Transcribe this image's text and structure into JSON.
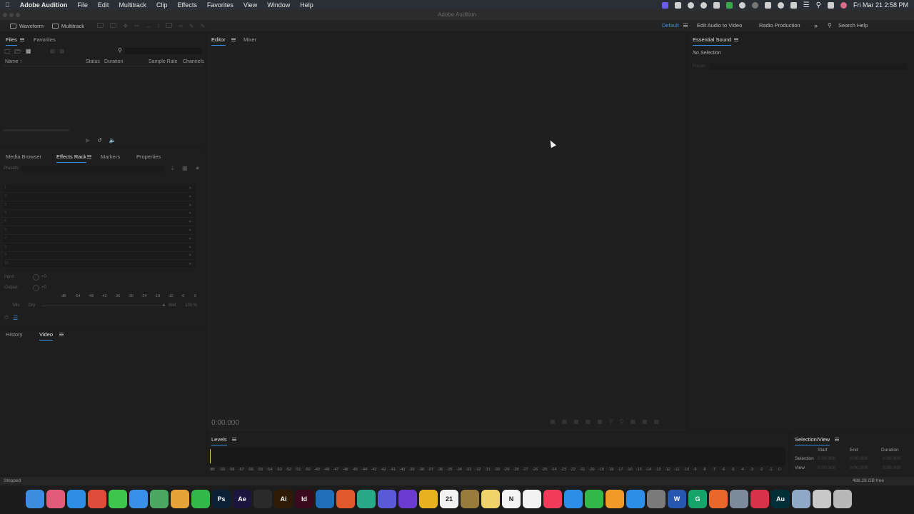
{
  "menubar": {
    "app_name": "Adobe Audition",
    "items": [
      "File",
      "Edit",
      "Multitrack",
      "Clip",
      "Effects",
      "Favorites",
      "View",
      "Window",
      "Help"
    ],
    "clock": "Fri Mar 21  2:58 PM"
  },
  "window": {
    "title": "Adobe Audition"
  },
  "toolbar": {
    "waveform_label": "Waveform",
    "multitrack_label": "Multitrack",
    "workspaces": [
      "Default",
      "Edit Audio to Video",
      "Radio Production"
    ],
    "search_placeholder": "Search Help",
    "accent": "#3b8fe8"
  },
  "files_panel": {
    "tabs": [
      "Files",
      "Favorites"
    ],
    "columns": [
      "Name ↑",
      "Status",
      "Duration",
      "Sample Rate",
      "Channels"
    ]
  },
  "effects_panel": {
    "tabs": [
      "Media Browser",
      "Effects Rack",
      "Markers",
      "Properties"
    ],
    "presets_label": "Presets:",
    "slots": [
      "1",
      "2",
      "3",
      "4",
      "5",
      "6",
      "7",
      "8",
      "9",
      "10"
    ],
    "input_label": "Input:",
    "input_value": "+0",
    "output_label": "Output:",
    "output_value": "+0",
    "meter_ticks": [
      "dB",
      "-54",
      "-48",
      "-42",
      "-36",
      "-30",
      "-24",
      "-18",
      "-12",
      "-6",
      "0"
    ],
    "mix_label": "Mix:",
    "dry_label": "Dry",
    "wet_label": "Wet",
    "wet_value": "100 %"
  },
  "history_panel": {
    "tabs": [
      "History",
      "Video"
    ]
  },
  "editor_panel": {
    "tabs": [
      "Editor",
      "Mixer"
    ],
    "time": "0:00.000"
  },
  "essential_sound": {
    "title": "Essential Sound",
    "no_selection": "No Selection",
    "preset_label": "Preset:"
  },
  "levels_panel": {
    "title": "Levels",
    "ruler": [
      "dB",
      "-59",
      "-58",
      "-57",
      "-56",
      "-55",
      "-54",
      "-53",
      "-52",
      "-51",
      "-50",
      "-49",
      "-48",
      "-47",
      "-46",
      "-45",
      "-44",
      "-43",
      "-42",
      "-41",
      "-40",
      "-39",
      "-38",
      "-37",
      "-36",
      "-35",
      "-34",
      "-33",
      "-32",
      "-31",
      "-30",
      "-29",
      "-28",
      "-27",
      "-26",
      "-25",
      "-24",
      "-23",
      "-22",
      "-21",
      "-20",
      "-19",
      "-18",
      "-17",
      "-16",
      "-15",
      "-14",
      "-13",
      "-12",
      "-11",
      "-10",
      "-9",
      "-8",
      "-7",
      "-6",
      "-5",
      "-4",
      "-3",
      "-2",
      "-1",
      "0"
    ]
  },
  "selection_view": {
    "title": "Selection/View",
    "headers": [
      "Start",
      "End",
      "Duration"
    ],
    "rows": [
      {
        "label": "Selection",
        "start": "0:00.000",
        "end": "0:00.000",
        "duration": "0:00.000"
      },
      {
        "label": "View",
        "start": "0:00.000",
        "end": "0:00.000",
        "duration": "0:00.000"
      }
    ]
  },
  "statusbar": {
    "state": "Stopped",
    "disk_free": "488.28 GB free"
  },
  "dock": [
    {
      "name": "finder-icon",
      "label": "",
      "color": "#3d8de0"
    },
    {
      "name": "launchpad-icon",
      "label": "",
      "color": "#e05c7a"
    },
    {
      "name": "safari-icon",
      "label": "",
      "color": "#2e8ee6"
    },
    {
      "name": "chrome-icon",
      "label": "",
      "color": "#e04b3a"
    },
    {
      "name": "messages-icon",
      "label": "",
      "color": "#3fc54e"
    },
    {
      "name": "mail-icon",
      "label": "",
      "color": "#3a8fe8"
    },
    {
      "name": "maps-icon",
      "label": "",
      "color": "#4aa860"
    },
    {
      "name": "photos-icon",
      "label": "",
      "color": "#e6a33a"
    },
    {
      "name": "facetime-icon",
      "label": "",
      "color": "#33b84a"
    },
    {
      "name": "photoshop-icon",
      "label": "Ps",
      "color": "#0d2136"
    },
    {
      "name": "after-effects-icon",
      "label": "Ae",
      "color": "#1c1540"
    },
    {
      "name": "podcast-icon",
      "label": "",
      "color": "#2a2a2a"
    },
    {
      "name": "illustrator-icon",
      "label": "Ai",
      "color": "#2f1a05"
    },
    {
      "name": "indesign-icon",
      "label": "Id",
      "color": "#3a0a1c"
    },
    {
      "name": "vscode-icon",
      "label": "",
      "color": "#1e6fb8"
    },
    {
      "name": "brave-icon",
      "label": "",
      "color": "#e05a2b"
    },
    {
      "name": "chatgpt-icon",
      "label": "",
      "color": "#2aa88a"
    },
    {
      "name": "settings-gear-icon",
      "label": "",
      "color": "#5a5ad8"
    },
    {
      "name": "github-icon",
      "label": "",
      "color": "#6b3bd0"
    },
    {
      "name": "cyberduck-icon",
      "label": "",
      "color": "#e8b21e"
    },
    {
      "name": "calendar-icon",
      "label": "21",
      "color": "#f2f2f2"
    },
    {
      "name": "archive-icon",
      "label": "",
      "color": "#9a7b3e"
    },
    {
      "name": "notes-icon",
      "label": "",
      "color": "#f0d36a"
    },
    {
      "name": "notion-icon",
      "label": "N",
      "color": "#f4f4f4"
    },
    {
      "name": "reminders-icon",
      "label": "",
      "color": "#f2f2f2"
    },
    {
      "name": "music-icon",
      "label": "",
      "color": "#f23b5a"
    },
    {
      "name": "keynote-icon",
      "label": "",
      "color": "#2c8ee8"
    },
    {
      "name": "numbers-icon",
      "label": "",
      "color": "#33b84a"
    },
    {
      "name": "pages-icon",
      "label": "",
      "color": "#f09a2a"
    },
    {
      "name": "app-store-icon",
      "label": "",
      "color": "#2d8ee8"
    },
    {
      "name": "system-settings-icon",
      "label": "",
      "color": "#7a7a7a"
    },
    {
      "name": "word-icon",
      "label": "W",
      "color": "#2656b0"
    },
    {
      "name": "grammarly-icon",
      "label": "G",
      "color": "#16a46a"
    },
    {
      "name": "firefox-icon",
      "label": "",
      "color": "#e8662a"
    },
    {
      "name": "preview-icon",
      "label": "",
      "color": "#7d8a9c"
    },
    {
      "name": "creative-cloud-icon",
      "label": "",
      "color": "#d8324a"
    },
    {
      "name": "audition-icon",
      "label": "Au",
      "color": "#002f3a"
    },
    {
      "name": "downloads-icon",
      "label": "",
      "color": "#8fa8c8"
    },
    {
      "name": "screenshot-folder-icon",
      "label": "",
      "color": "#c8c8c8"
    },
    {
      "name": "trash-icon",
      "label": "",
      "color": "#b8b8b8"
    }
  ]
}
